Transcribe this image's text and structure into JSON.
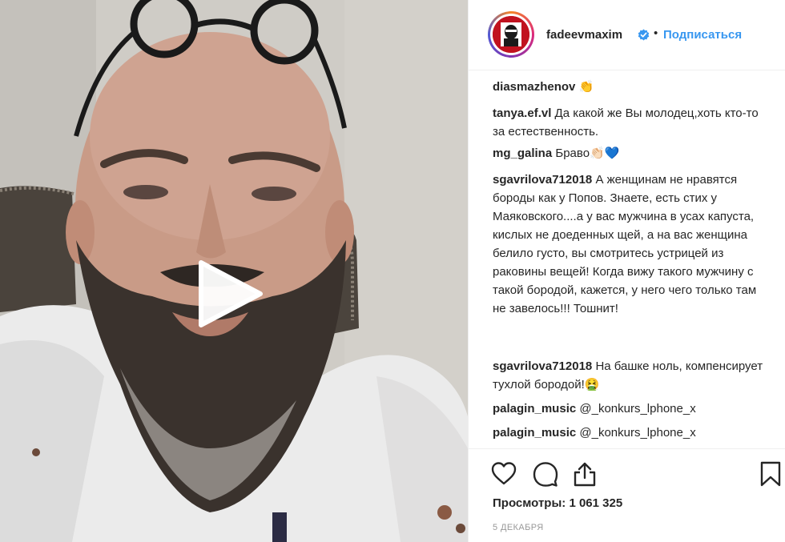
{
  "media": {
    "type": "video",
    "play_icon": "play-icon"
  },
  "header": {
    "username": "fadeevmaxim",
    "verified_icon": "verified-badge-icon",
    "separator": "•",
    "follow_label": "Подписаться"
  },
  "comments": [
    {
      "user": "diasmazhenov",
      "text": "👏"
    },
    {
      "user": "tanya.ef.vl",
      "text": "Да какой же Вы молодец,хоть кто-то за естественность."
    },
    {
      "user": "mg_galina",
      "text": "Браво👏🏻💙"
    },
    {
      "user": "sgavrilova712018",
      "text": "А женщинам не нравятся бороды как у Попов. Знаете, есть стих у Маяковского....а у вас мужчина в усах капуста, кислых не доеденных щей, а на вас женщина белило густо, вы смотритесь устрицей из раковины вещей! Когда вижу такого мужчину с такой бородой, кажется, у него чего только там не завелось!!! Тошнит!"
    },
    {
      "user": "sgavrilova712018",
      "text": "На башке ноль, компенсирует тухлой бородой!🤮"
    },
    {
      "user": "palagin_music",
      "mention": "@_konkurs_lphone_x"
    },
    {
      "user": "palagin_music",
      "mention": "@_konkurs_lphone_x"
    }
  ],
  "actions": {
    "like_icon": "heart-icon",
    "comment_icon": "comment-icon",
    "share_icon": "share-icon",
    "save_icon": "bookmark-icon"
  },
  "views": {
    "label": "Просмотры:",
    "count": "1 061 325"
  },
  "date": "5 ДЕКАБРЯ",
  "colors": {
    "link_blue": "#3897f0",
    "text": "#262626",
    "muted": "#999999",
    "border": "#efefef"
  }
}
